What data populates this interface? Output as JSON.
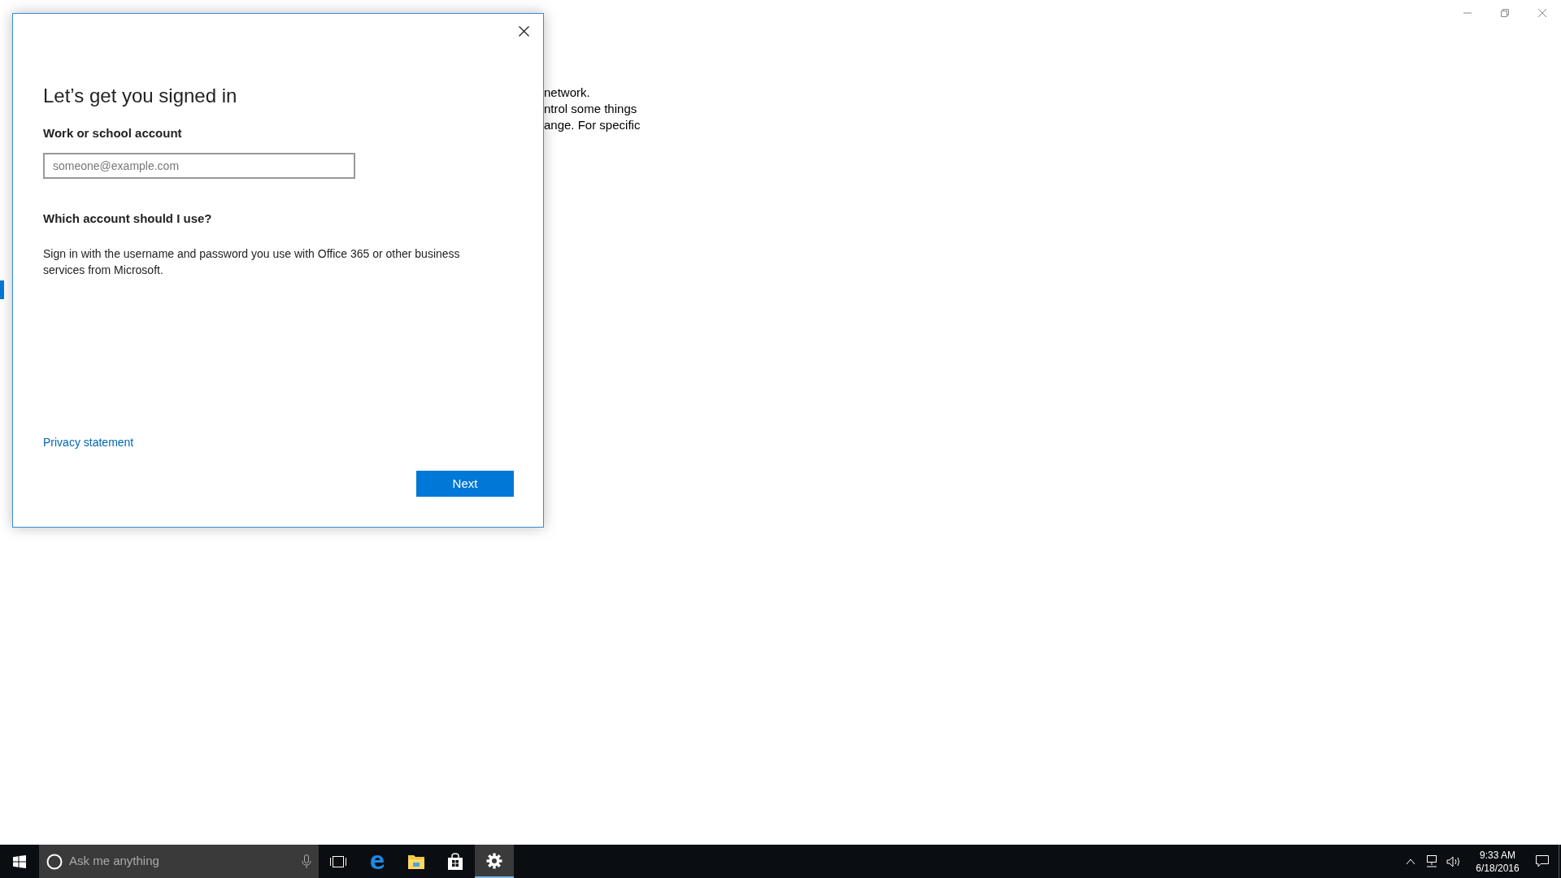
{
  "background_text": [
    "network.",
    "ntrol some things",
    "ange. For specific"
  ],
  "dialog": {
    "title": "Let’s get you signed in",
    "field_label": "Work or school account",
    "field": {
      "placeholder": "someone@example.com"
    },
    "help_heading": "Which account should I use?",
    "help_text": "Sign in with the username and password you use with Office 365 or other business services from Microsoft.",
    "privacy_link": "Privacy statement",
    "next_button": "Next"
  },
  "taskbar": {
    "search": {
      "placeholder": "Ask me anything"
    },
    "apps": [
      {
        "kind": "task-view",
        "selected": false
      },
      {
        "kind": "browser",
        "selected": false
      },
      {
        "kind": "folder",
        "selected": false
      },
      {
        "kind": "store",
        "selected": false
      },
      {
        "kind": "settings",
        "selected": true
      }
    ],
    "clock": {
      "time": "9:33 AM",
      "date": "6/18/2016"
    }
  }
}
